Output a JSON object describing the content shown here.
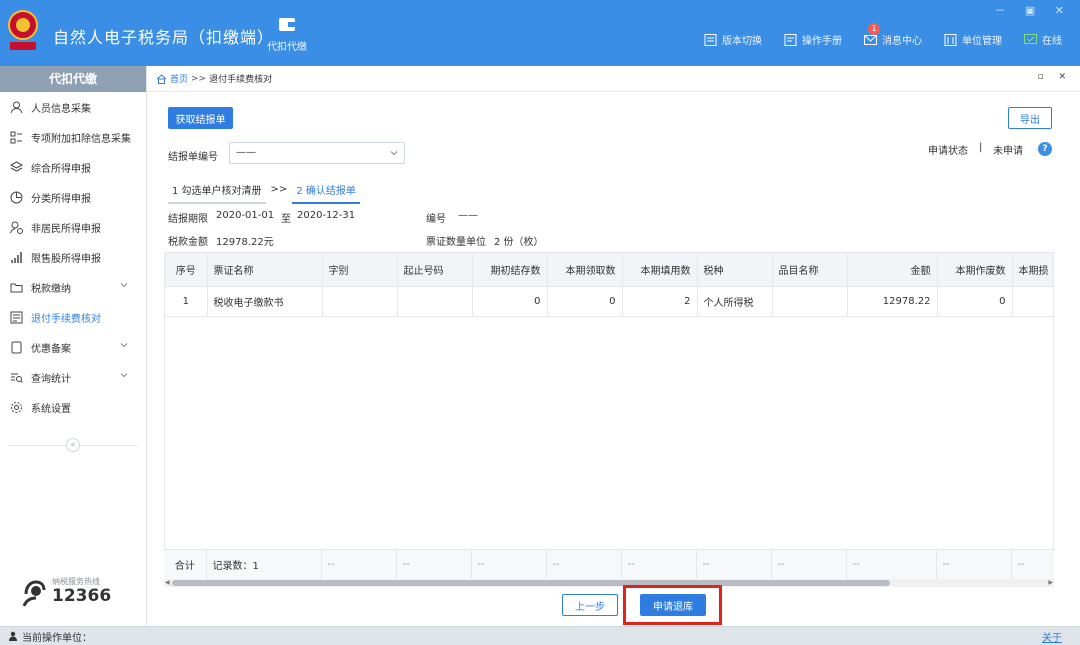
{
  "app": {
    "title": "自然人电子税务局（扣缴端）",
    "module_label": "代扣代缴",
    "window_controls": "－ ▣ ✕",
    "actions": [
      {
        "label": "版本切换",
        "icon": "document-icon"
      },
      {
        "label": "操作手册",
        "icon": "manual-icon"
      },
      {
        "label": "消息中心",
        "icon": "mail-icon",
        "badge": "1"
      },
      {
        "label": "单位管理",
        "icon": "building-icon"
      },
      {
        "label": "在线",
        "icon": "online-icon"
      }
    ]
  },
  "sidebar": {
    "header": "代扣代缴",
    "items": [
      {
        "label": "人员信息采集",
        "icon": "person-icon"
      },
      {
        "label": "专项附加扣除信息采集",
        "icon": "list-icon"
      },
      {
        "label": "综合所得申报",
        "icon": "layers-icon"
      },
      {
        "label": "分类所得申报",
        "icon": "pie-chart-icon"
      },
      {
        "label": "非居民所得申报",
        "icon": "person-globe-icon"
      },
      {
        "label": "限售股所得申报",
        "icon": "bar-signal-icon"
      },
      {
        "label": "税款缴纳",
        "icon": "folder-icon",
        "expandable": true
      },
      {
        "label": "退付手续费核对",
        "icon": "checklist-icon",
        "active": true
      },
      {
        "label": "优惠备案",
        "icon": "doc-icon",
        "expandable": true
      },
      {
        "label": "查询统计",
        "icon": "search-list-icon",
        "expandable": true
      },
      {
        "label": "系统设置",
        "icon": "gear-icon"
      }
    ],
    "collapse_glyph": "«",
    "hotline_label": "纳税服务热线",
    "hotline_number": "12366"
  },
  "breadcrumb": {
    "home": "首页",
    "separator": ">>",
    "current": "退付手续费核对"
  },
  "tab_controls": "▫ ✕",
  "toolbar": {
    "fetch_button": "获取结报单",
    "export_button": "导出"
  },
  "form": {
    "report_no_label": "结报单编号",
    "report_no_value": "——",
    "apply_status_label": "申请状态",
    "apply_status_sep": "|",
    "apply_status_value": "未申请",
    "help_glyph": "?"
  },
  "steps": [
    {
      "label": "1 勾选单户核对清册",
      "active": false
    },
    {
      "label": "2 确认结报单",
      "active": true
    }
  ],
  "step_separator": ">>",
  "info": {
    "period_label": "结报期限",
    "period_start": "2020-01-01",
    "period_to": "至",
    "period_end": "2020-12-31",
    "code_label": "编号",
    "code_value": "——",
    "tax_amount_label": "税款金额",
    "tax_amount_value": "12978.22元",
    "ticket_count_label": "票证数量单位",
    "ticket_count_value": "2 份（枚）"
  },
  "table": {
    "columns": [
      "序号",
      "票证名称",
      "字别",
      "起止号码",
      "期初结存数",
      "本期领取数",
      "本期填用数",
      "税种",
      "品目名称",
      "金额",
      "本期作废数",
      "本期损"
    ],
    "rows": [
      [
        "1",
        "税收电子缴款书",
        "",
        "",
        "0",
        "0",
        "2",
        "个人所得税",
        "",
        "12978.22",
        "0",
        ""
      ]
    ],
    "footer": [
      "合计",
      "记录数：1",
      "--",
      "--",
      "--",
      "--",
      "--",
      "--",
      "--",
      "--",
      "--",
      "--"
    ]
  },
  "bottom_buttons": {
    "prev": "上一步",
    "apply": "申请退库"
  },
  "statusbar": {
    "label": "当前操作单位：",
    "about": "关于"
  },
  "colors": {
    "primary": "#3a8ee6",
    "accent": "#2f7de1",
    "highlight": "#e2231a"
  }
}
